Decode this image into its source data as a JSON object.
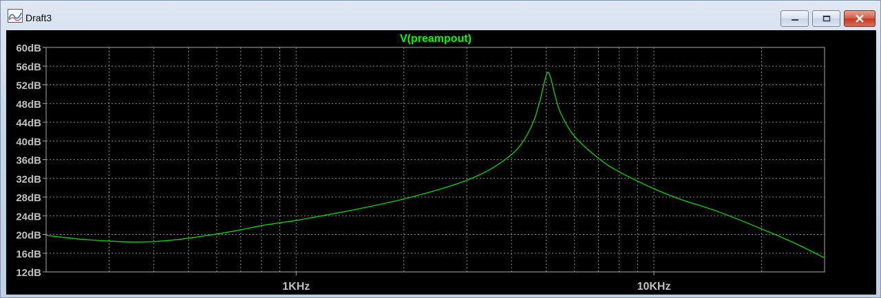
{
  "window": {
    "title": "Draft3",
    "icon": "waveform-viewer-icon",
    "buttons": [
      "minimize-icon",
      "maximize-icon",
      "close-icon"
    ]
  },
  "colors": {
    "background": "#000000",
    "trace": "#00d800",
    "title": "#00ff00",
    "axis_text": "#c0c0c0",
    "grid": "#8a8a8a",
    "frame": "#a8a8a8"
  },
  "chart_data": {
    "type": "line",
    "title": "V(preampout)",
    "xlabel": "",
    "ylabel": "",
    "xscale": "log",
    "xlim": [
      200,
      30000
    ],
    "ylim": [
      12,
      60
    ],
    "ytick_step": 4,
    "ytick_labels": [
      "60dB",
      "56dB",
      "52dB",
      "48dB",
      "44dB",
      "40dB",
      "36dB",
      "32dB",
      "28dB",
      "24dB",
      "20dB",
      "16dB",
      "12dB"
    ],
    "xtick_labels": [
      {
        "value": 1000,
        "label": "1KHz"
      },
      {
        "value": 10000,
        "label": "10KHz"
      }
    ],
    "grid": true,
    "legend": "none",
    "series": [
      {
        "color": "#00d800",
        "x": [
          200,
          250,
          300,
          350,
          400,
          450,
          500,
          600,
          700,
          800,
          900,
          1000,
          1200,
          1500,
          2000,
          2500,
          3000,
          3500,
          4000,
          4300,
          4600,
          4800,
          4950,
          5050,
          5150,
          5300,
          5500,
          6000,
          7000,
          8000,
          10000,
          12000,
          15000,
          20000,
          25000,
          30000
        ],
        "y": [
          19.8,
          19.0,
          18.6,
          18.4,
          18.5,
          18.8,
          19.2,
          20.1,
          21.0,
          21.9,
          22.5,
          23.0,
          24.1,
          25.5,
          27.6,
          29.6,
          31.6,
          34.0,
          37.1,
          39.8,
          44.0,
          48.5,
          52.8,
          54.7,
          53.4,
          49.6,
          45.8,
          41.0,
          36.3,
          33.4,
          29.8,
          27.4,
          25.0,
          21.2,
          18.0,
          15.0
        ]
      }
    ]
  }
}
